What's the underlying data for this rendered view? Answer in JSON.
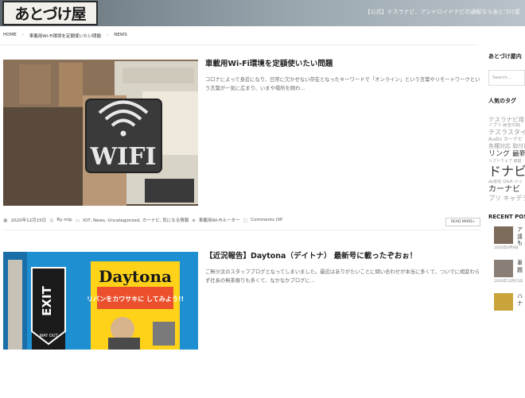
{
  "header": {
    "logo_text": "あとづけ屋",
    "notice": "【公式】テスラナビ、アンドロイドナビの通販ならあとづけ屋"
  },
  "breadcrumb": {
    "home": "HOME",
    "page": "車載用Wi-Fi環境を定額使いたい問題",
    "section": "NEWS",
    "sep": "›"
  },
  "posts": [
    {
      "title": "車載用Wi-Fi環境を定額使いたい問題",
      "excerpt": "コロナによって身近になり、日常に欠かせない存在となったキーワードで「オンライン」という言葉やリモートワークという言葉が一気に広まり、いまや場所を問わ…",
      "date": "2020年12月15日",
      "author": "By mlp",
      "categories": "IOT, News, Uncategorized, カーナビ, 気になる情報",
      "tag": "車載用Wi-Fiルーター",
      "comments": "Comments Off",
      "read_more": "READ MORE»",
      "sign_text": "WIFI"
    },
    {
      "title": "【近況報告】Daytona（デイトナ） 最新号に載ったぞおぉ！",
      "excerpt": "ご無沙汰のスタッフブログとなってしまいました。最近はありがたいことに問い合わせが本当に多くて、ついでに相変わらず社長の無茶振りも多くて、なかなかブログに…",
      "magazine_title": "Daytona",
      "magazine_headline": "リバンをカワサキに してみよう!!",
      "exit_text": "EXIT",
      "way_out_text": "WAY OUT"
    }
  ],
  "sidebar": {
    "about_heading": "あとづけ屋内",
    "search_placeholder": "Search...",
    "tags_heading": "人気のタグ",
    "tags": [
      {
        "label": "テスラナビ用",
        "size": 7.5
      },
      {
        "label": "アプリ 新型の取",
        "size": 5.5
      },
      {
        "label": "テスラスタイル",
        "size": 8
      },
      {
        "label": "Audio カーナビ",
        "size": 6
      },
      {
        "label": "各種対応 取付け",
        "size": 7
      },
      {
        "label": "リング 最新ナビ",
        "size": 9
      },
      {
        "label": "ソフトウェア 取扱",
        "size": 5
      },
      {
        "label": "ドナビ",
        "size": 16
      },
      {
        "label": "高速化 Q&A ディ",
        "size": 5.5
      },
      {
        "label": "カーナビ",
        "size": 10
      },
      {
        "label": "プリ キャデラ",
        "size": 8
      }
    ],
    "recent_heading": "RECENT POSTS",
    "recent": [
      {
        "text": "ア\n遠\nも",
        "date": "2020年6月9日"
      },
      {
        "text": "車\n題",
        "date": "2020年12月15日"
      },
      {
        "text": "ハ\nナ",
        "date": ""
      }
    ]
  },
  "colors": {
    "accent": "#ffd21a",
    "blue_wall": "#1e8fd0"
  }
}
